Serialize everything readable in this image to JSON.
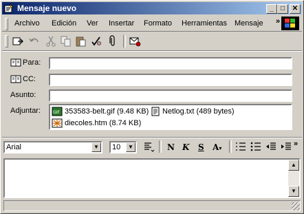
{
  "window": {
    "title": "Mensaje nuevo"
  },
  "menu": {
    "items": [
      {
        "label": "Archivo"
      },
      {
        "label": "Edición"
      },
      {
        "label": "Ver"
      },
      {
        "label": "Insertar"
      },
      {
        "label": "Formato"
      },
      {
        "label": "Herramientas"
      },
      {
        "label": "Mensaje"
      }
    ],
    "overflow": "»"
  },
  "toolbar": {
    "icons": [
      "send-icon",
      "undo-icon",
      "cut-icon",
      "copy-icon",
      "paste-icon",
      "check-names-icon",
      "attach-icon",
      "sign-icon"
    ]
  },
  "fields": {
    "to_label": "Para:",
    "cc_label": "CC:",
    "subject_label": "Asunto:",
    "attach_label": "Adjuntar:",
    "to_value": "",
    "cc_value": "",
    "subject_value": ""
  },
  "attachments": [
    {
      "name": "353583-belt.gif (9.48 KB)",
      "icon": "gif-file-icon"
    },
    {
      "name": "Netlog.txt (489 bytes)",
      "icon": "text-file-icon"
    },
    {
      "name": "diecoles.htm (8.74 KB)",
      "icon": "html-file-icon"
    }
  ],
  "format": {
    "font": "Arial",
    "size": "10",
    "overflow": "»"
  },
  "colors": {
    "title_start": "#0a246a",
    "title_end": "#a6caf0",
    "chrome": "#d4d0c8"
  }
}
